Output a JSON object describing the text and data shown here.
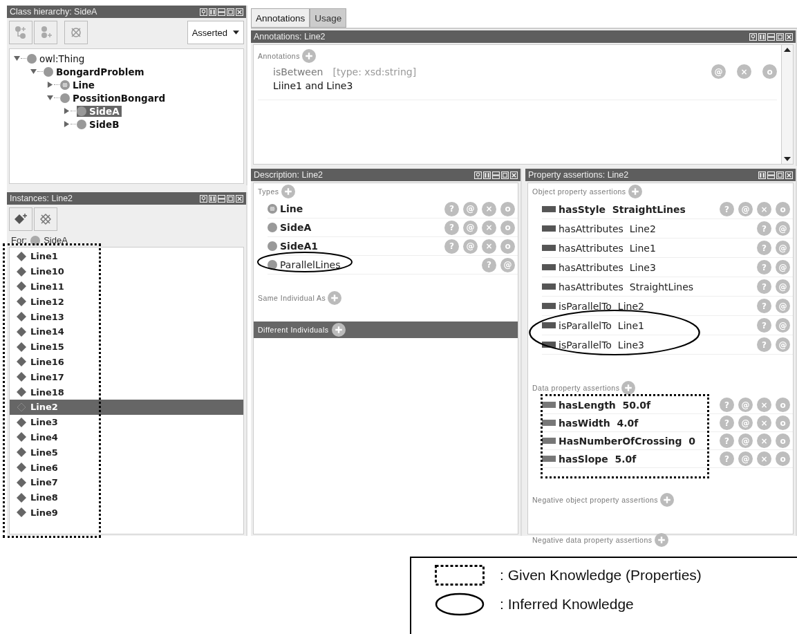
{
  "class_hierarchy": {
    "title": "Class hierarchy: SideA",
    "has_help": true,
    "view_mode": "Asserted",
    "tree": [
      {
        "label": "owl:Thing",
        "kind": "primitive",
        "bold": false,
        "expanded": true,
        "selected": false,
        "children": [
          {
            "label": "BongardProblem",
            "kind": "primitive",
            "bold": true,
            "expanded": true,
            "selected": false,
            "children": [
              {
                "label": "Line",
                "kind": "defined",
                "bold": true,
                "expanded": false,
                "selected": false
              },
              {
                "label": "PossitionBongard",
                "kind": "primitive",
                "bold": true,
                "expanded": true,
                "selected": false,
                "children": [
                  {
                    "label": "SideA",
                    "kind": "primitive",
                    "bold": true,
                    "expanded": false,
                    "selected": true
                  },
                  {
                    "label": "SideB",
                    "kind": "primitive",
                    "bold": true,
                    "expanded": false,
                    "selected": false
                  }
                ]
              }
            ]
          }
        ]
      }
    ]
  },
  "instances": {
    "title": "Instances: Line2",
    "has_help": true,
    "for_label": "For:",
    "for_class": "SideA",
    "given": true,
    "items": [
      {
        "label": "Line1",
        "selected": false
      },
      {
        "label": "Line10",
        "selected": false
      },
      {
        "label": "Line11",
        "selected": false
      },
      {
        "label": "Line12",
        "selected": false
      },
      {
        "label": "Line13",
        "selected": false
      },
      {
        "label": "Line14",
        "selected": false
      },
      {
        "label": "Line15",
        "selected": false
      },
      {
        "label": "Line16",
        "selected": false
      },
      {
        "label": "Line17",
        "selected": false
      },
      {
        "label": "Line18",
        "selected": false
      },
      {
        "label": "Line2",
        "selected": true
      },
      {
        "label": "Line3",
        "selected": false
      },
      {
        "label": "Line4",
        "selected": false
      },
      {
        "label": "Line5",
        "selected": false
      },
      {
        "label": "Line6",
        "selected": false
      },
      {
        "label": "Line7",
        "selected": false
      },
      {
        "label": "Line8",
        "selected": false
      },
      {
        "label": "Line9",
        "selected": false
      }
    ]
  },
  "tabs": [
    {
      "label": "Annotations",
      "selected": true
    },
    {
      "label": "Usage",
      "selected": false
    }
  ],
  "annotations": {
    "title": "Annotations: Line2",
    "has_help": true,
    "section": "Annotations",
    "items": [
      {
        "property": "isBetween",
        "type": "[type: xsd:string]",
        "value": "Liine1 and Line3",
        "actions": [
          "@",
          "×",
          "o"
        ]
      }
    ]
  },
  "description": {
    "title": "Description: Line2",
    "has_help": true,
    "types_label": "Types",
    "types": [
      {
        "label": "Line",
        "kind": "defined",
        "asserted": true,
        "circled": false,
        "actions": [
          "?",
          "@",
          "×",
          "o"
        ]
      },
      {
        "label": "SideA",
        "kind": "primitive",
        "asserted": true,
        "circled": false,
        "actions": [
          "?",
          "@",
          "×",
          "o"
        ]
      },
      {
        "label": "SideA1",
        "kind": "primitive",
        "asserted": true,
        "circled": false,
        "actions": [
          "?",
          "@",
          "×",
          "o"
        ]
      },
      {
        "label": "ParallelLines",
        "kind": "primitive",
        "asserted": false,
        "circled": true,
        "actions": [
          "?",
          "@"
        ]
      }
    ],
    "same_label": "Same Individual As",
    "different_label": "Different Individuals"
  },
  "property_assertions": {
    "title": "Property assertions: Line2",
    "has_help": false,
    "object_label": "Object property assertions",
    "object_rows": [
      {
        "property": "hasStyle",
        "value": "StraightLines",
        "asserted": true,
        "circled": false,
        "actions": [
          "?",
          "@",
          "×",
          "o"
        ]
      },
      {
        "property": "hasAttributes",
        "value": "Line2",
        "asserted": false,
        "circled": false,
        "actions": [
          "?",
          "@"
        ]
      },
      {
        "property": "hasAttributes",
        "value": "Line1",
        "asserted": false,
        "circled": false,
        "actions": [
          "?",
          "@"
        ]
      },
      {
        "property": "hasAttributes",
        "value": "Line3",
        "asserted": false,
        "circled": false,
        "actions": [
          "?",
          "@"
        ]
      },
      {
        "property": "hasAttributes",
        "value": "StraightLines",
        "asserted": false,
        "circled": false,
        "actions": [
          "?",
          "@"
        ]
      },
      {
        "property": "isParallelTo",
        "value": "Line2",
        "asserted": false,
        "circled": false,
        "actions": [
          "?",
          "@"
        ]
      },
      {
        "property": "isParallelTo",
        "value": "Line1",
        "asserted": false,
        "circled": true,
        "actions": [
          "?",
          "@"
        ]
      },
      {
        "property": "isParallelTo",
        "value": "Line3",
        "asserted": false,
        "circled": true,
        "actions": [
          "?",
          "@"
        ]
      }
    ],
    "data_label": "Data property assertions",
    "data_rows": [
      {
        "property": "hasLength",
        "value": "50.0f",
        "asserted": true,
        "given": true,
        "actions": [
          "?",
          "@",
          "×",
          "o"
        ]
      },
      {
        "property": "hasWidth",
        "value": "4.0f",
        "asserted": true,
        "given": true,
        "actions": [
          "?",
          "@",
          "×",
          "o"
        ]
      },
      {
        "property": "HasNumberOfCrossing",
        "value": "0",
        "asserted": true,
        "given": true,
        "actions": [
          "?",
          "@",
          "×",
          "o"
        ]
      },
      {
        "property": "hasSlope",
        "value": "5.0f",
        "asserted": true,
        "given": true,
        "actions": [
          "?",
          "@",
          "×",
          "o"
        ]
      }
    ],
    "negative_object_label": "Negative object property assertions",
    "negative_data_label": "Negative data property assertions"
  },
  "legend": {
    "items": [
      {
        "kind": "dashed-box",
        "label": ": Given Knowledge (Properties)"
      },
      {
        "kind": "ellipse",
        "label": ": Inferred Knowledge"
      }
    ]
  }
}
